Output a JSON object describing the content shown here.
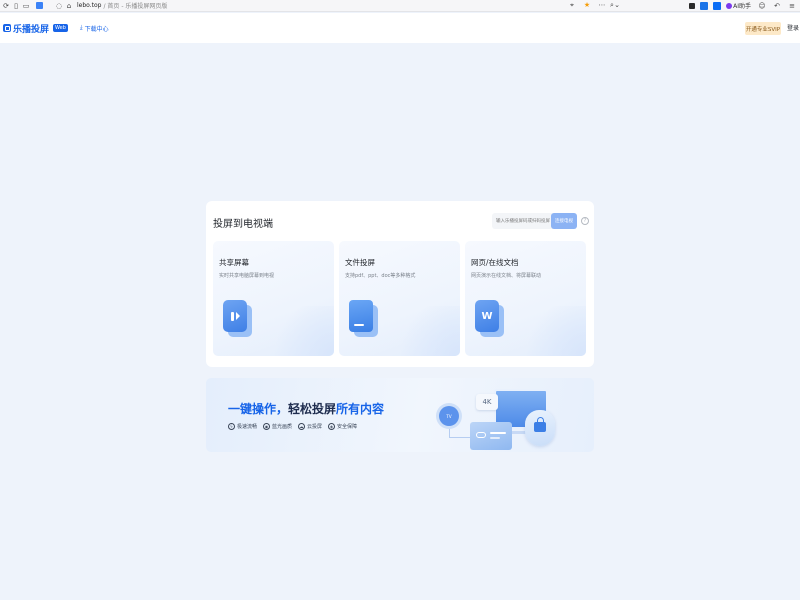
{
  "browser": {
    "url_domain": "lebo.top",
    "url_rest": "/ 首页 - 乐播投屏网页版",
    "ai_label": "AI助手"
  },
  "header": {
    "logo_text": "乐播投屏",
    "logo_badge": "Web",
    "download_label": "下载中心",
    "vip_label": "开通专业SVIP",
    "login_label": "登录"
  },
  "cast_card": {
    "title": "投屏到电视端",
    "code_placeholder": "输入乐播投屏码或扫码投屏",
    "connect_label": "连接电视",
    "help_icon": "question-icon",
    "features": [
      {
        "title": "共享屏幕",
        "desc": "实时共享电脑屏幕到电视",
        "icon": "screen-share-icon"
      },
      {
        "title": "文件投屏",
        "desc": "支持pdf、ppt、doc等多种格式",
        "icon": "folder-icon"
      },
      {
        "title": "网页/在线文档",
        "desc": "网页演示在线文档、将屏幕联动",
        "icon": "word-doc-icon",
        "glyph": "W"
      }
    ]
  },
  "banner": {
    "headline_part1": "一键操作，",
    "headline_part2": "轻松投屏",
    "headline_part3": "所有内容",
    "tags": [
      {
        "label": "极速流畅",
        "icon": "lightning-icon"
      },
      {
        "label": "蓝光画质",
        "icon": "hd-icon"
      },
      {
        "label": "云投屏",
        "icon": "cloud-icon"
      },
      {
        "label": "安全保障",
        "icon": "shield-icon"
      }
    ],
    "badge_4k": "4K",
    "tv_label": "TV"
  },
  "colors": {
    "brand": "#1764e8",
    "page_bg": "#eef3fb",
    "vip_bg": "#fde9c8"
  }
}
